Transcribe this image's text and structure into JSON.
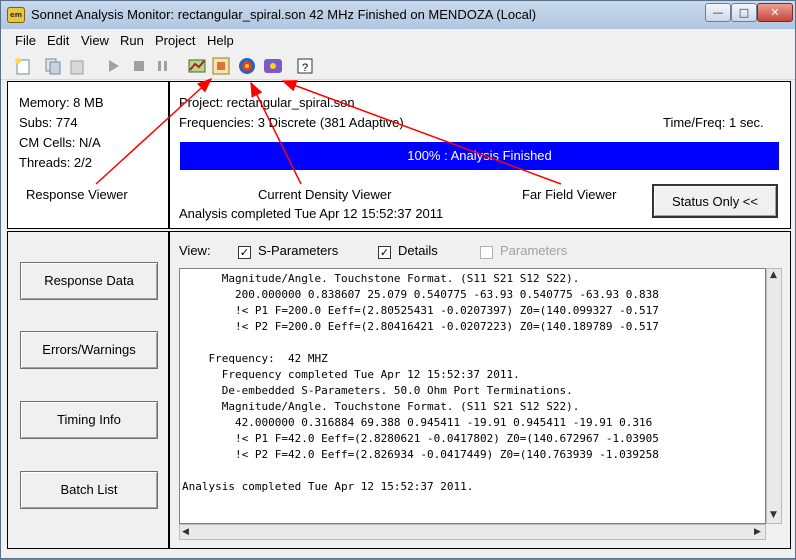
{
  "window": {
    "title": "Sonnet Analysis Monitor: rectangular_spiral.son  42 MHz Finished on MENDOZA (Local)",
    "icon_label": "em"
  },
  "menu": [
    "File",
    "Edit",
    "View",
    "Run",
    "Project",
    "Help"
  ],
  "stats": {
    "memory": "Memory: 8 MB",
    "subs": "Subs: 774",
    "cm_cells": "CM Cells: N/A",
    "threads": "Threads: 2/2"
  },
  "project": {
    "project_line": "Project:  rectangular_spiral.son",
    "frequencies_line": "Frequencies:  3 Discrete (381 Adaptive)",
    "timefreq": "Time/Freq:  1 sec.",
    "progress_text": "100% :  Analysis Finished",
    "progress_fraction": 1.0,
    "completed": "Analysis completed Tue Apr 12 15:52:37 2011",
    "status_button": "Status Only <<"
  },
  "callouts": {
    "response_viewer": "Response Viewer",
    "current_density_viewer": "Current Density Viewer",
    "far_field_viewer": "Far Field Viewer"
  },
  "side_buttons": [
    "Response Data",
    "Errors/Warnings",
    "Timing Info",
    "Batch List"
  ],
  "view": {
    "label": "View:",
    "options": [
      {
        "label": "S-Parameters",
        "checked": true,
        "enabled": true
      },
      {
        "label": "Details",
        "checked": true,
        "enabled": true
      },
      {
        "label": "Parameters",
        "checked": false,
        "enabled": false
      }
    ]
  },
  "log_lines": [
    "      Magnitude/Angle. Touchstone Format. (S11 S21 S12 S22).",
    "        200.000000 0.838607 25.079 0.540775 -63.93 0.540775 -63.93 0.838",
    "        !< P1 F=200.0 Eeff=(2.80525431 -0.0207397) Z0=(140.099327 -0.517",
    "        !< P2 F=200.0 Eeff=(2.80416421 -0.0207223) Z0=(140.189789 -0.517",
    "",
    "    Frequency:  42 MHZ",
    "      Frequency completed Tue Apr 12 15:52:37 2011.",
    "      De-embedded S-Parameters. 50.0 Ohm Port Terminations.",
    "      Magnitude/Angle. Touchstone Format. (S11 S21 S12 S22).",
    "        42.000000 0.316884 69.388 0.945411 -19.91 0.945411 -19.91 0.316",
    "        !< P1 F=42.0 Eeff=(2.8280621 -0.0417802) Z0=(140.672967 -1.03905",
    "        !< P2 F=42.0 Eeff=(2.826934 -0.0417449) Z0=(140.763939 -1.039258",
    "",
    "Analysis completed Tue Apr 12 15:52:37 2011."
  ],
  "toolbar_icons": [
    "new-file-icon",
    "copy-icon",
    "paste-icon",
    "run-icon",
    "stop-icon",
    "pause-icon",
    "response-viewer-icon",
    "current-density-viewer-icon",
    "far-field-viewer-icon",
    "help-icon"
  ],
  "colors": {
    "progress_fill": "#0000ff",
    "arrow": "#ff0000"
  }
}
